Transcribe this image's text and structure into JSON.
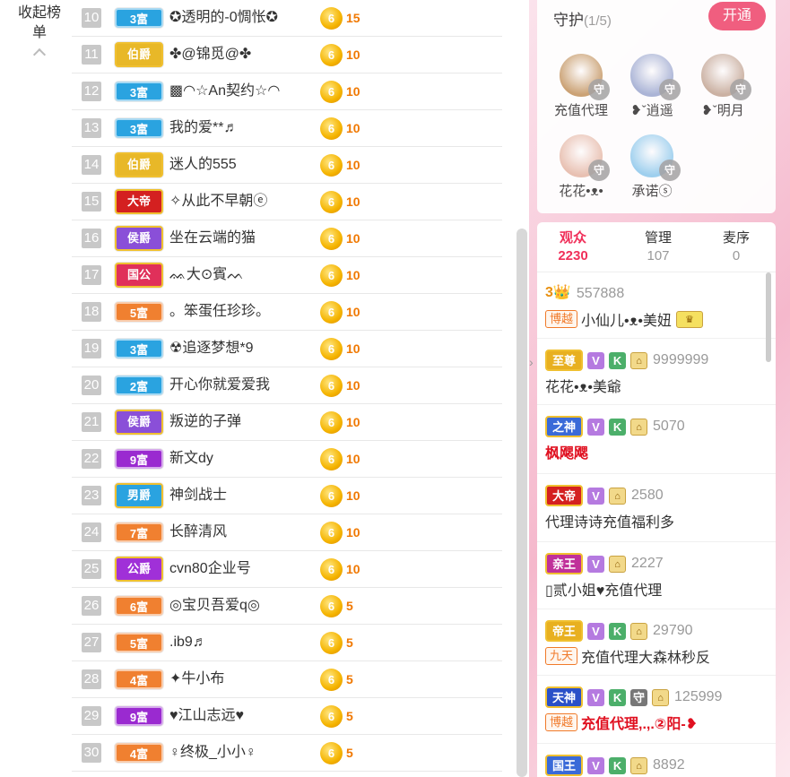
{
  "collapse_label": "收起榜单",
  "ranking": [
    {
      "rank": "10",
      "badge": "3富",
      "badge_color": "#2aa3e0",
      "name": "✪透明的-0惆怅✪",
      "score": "15"
    },
    {
      "rank": "11",
      "badge": "伯爵",
      "badge_color": "#e8b828",
      "name": "✤@锦觅@✤",
      "score": "10"
    },
    {
      "rank": "12",
      "badge": "3富",
      "badge_color": "#2aa3e0",
      "name": "▩◠☆An契约☆◠",
      "score": "10"
    },
    {
      "rank": "13",
      "badge": "3富",
      "badge_color": "#2aa3e0",
      "name": "我的爱**♬",
      "score": "10"
    },
    {
      "rank": "14",
      "badge": "伯爵",
      "badge_color": "#e8b828",
      "name": "迷人的555",
      "score": "10"
    },
    {
      "rank": "15",
      "badge": "大帝",
      "badge_color": "#d42020",
      "name": "✧从此不早朝ⓔ",
      "score": "10"
    },
    {
      "rank": "16",
      "badge": "侯爵",
      "badge_color": "#8a4fd8",
      "name": "坐在云端的猫",
      "score": "10"
    },
    {
      "rank": "17",
      "badge": "国公",
      "badge_color": "#e0305a",
      "name": "ᨐ大⊙賓ᨓ",
      "score": "10"
    },
    {
      "rank": "18",
      "badge": "5富",
      "badge_color": "#f08030",
      "name": "。笨蛋任珍珍。",
      "score": "10"
    },
    {
      "rank": "19",
      "badge": "3富",
      "badge_color": "#2aa3e0",
      "name": "☢追逐梦想*9",
      "score": "10"
    },
    {
      "rank": "20",
      "badge": "2富",
      "badge_color": "#2aa3e0",
      "name": "开心你就爱爱我",
      "score": "10"
    },
    {
      "rank": "21",
      "badge": "侯爵",
      "badge_color": "#8a4fd8",
      "name": "叛逆的子弹",
      "score": "10"
    },
    {
      "rank": "22",
      "badge": "9富",
      "badge_color": "#9a2ad0",
      "name": "新文dy",
      "score": "10"
    },
    {
      "rank": "23",
      "badge": "男爵",
      "badge_color": "#2aa3e0",
      "name": "神剑战士",
      "score": "10"
    },
    {
      "rank": "24",
      "badge": "7富",
      "badge_color": "#f08030",
      "name": "长醉清风",
      "score": "10"
    },
    {
      "rank": "25",
      "badge": "公爵",
      "badge_color": "#a030d8",
      "name": "cvn80企业号",
      "score": "10"
    },
    {
      "rank": "26",
      "badge": "6富",
      "badge_color": "#f08030",
      "name": "◎宝贝吾爱q◎",
      "score": "5"
    },
    {
      "rank": "27",
      "badge": "5富",
      "badge_color": "#f08030",
      "name": ".ib9♬",
      "score": "5"
    },
    {
      "rank": "28",
      "badge": "4富",
      "badge_color": "#f08030",
      "name": "✦牛小布",
      "score": "5"
    },
    {
      "rank": "29",
      "badge": "9富",
      "badge_color": "#9a2ad0",
      "name": "♥江山志远♥",
      "score": "5"
    },
    {
      "rank": "30",
      "badge": "4富",
      "badge_color": "#f08030",
      "name": "♀终极_小小♀",
      "score": "5"
    }
  ],
  "coin_symbol": "6",
  "guard": {
    "title": "守护",
    "count": "(1/5)",
    "open_label": "开通",
    "guard_tag": "守",
    "members": [
      {
        "name": "充值代理",
        "color": "#c9a070"
      },
      {
        "name": "❥ˇ逍遥",
        "color": "#a7b3d6"
      },
      {
        "name": "❥ˇ明月",
        "color": "#c9b0a0"
      },
      {
        "name": "花花•ᴥ•",
        "color": "#e8c0b0"
      },
      {
        "name": "承诺ⓢ",
        "color": "#9ad0f0"
      }
    ]
  },
  "audience": {
    "tabs": [
      {
        "label": "观众",
        "count": "2230"
      },
      {
        "label": "管理",
        "count": "107"
      },
      {
        "label": "麦序",
        "count": "0"
      }
    ],
    "users": [
      {
        "badge": "3👑",
        "badge_color": "#f0a020",
        "icons": [],
        "id": "557888",
        "fan": "博越",
        "name": "小仙儿•ᴥ•美妞"
      },
      {
        "badge": "至尊",
        "badge_color": "#e8b020",
        "icons": [
          "V",
          "K",
          "H"
        ],
        "id": "9999999",
        "fan": "",
        "name": "花花•ᴥ•美爺"
      },
      {
        "badge": "之神",
        "badge_color": "#3a6ad8",
        "icons": [
          "V",
          "K",
          "H"
        ],
        "id": "5070",
        "fan": "",
        "name": "枫飔飔"
      },
      {
        "badge": "大帝",
        "badge_color": "#d42020",
        "icons": [
          "V",
          "H"
        ],
        "id": "2580",
        "fan": "",
        "name": "代理诗诗充值福利多"
      },
      {
        "badge": "亲王",
        "badge_color": "#c0309a",
        "icons": [
          "V",
          "H"
        ],
        "id": "2227",
        "fan": "",
        "name": "▯贰小姐♥充值代理"
      },
      {
        "badge": "帝王",
        "badge_color": "#e8b020",
        "icons": [
          "V",
          "K",
          "H"
        ],
        "id": "29790",
        "fan": "九天",
        "name": "充值代理大森林秒反"
      },
      {
        "badge": "天神",
        "badge_color": "#2a50c8",
        "icons": [
          "V",
          "K",
          "S",
          "H"
        ],
        "id": "125999",
        "fan": "博越",
        "name": "充值代理,.,.②阳-❥"
      },
      {
        "badge": "国王",
        "badge_color": "#3a6ad8",
        "icons": [
          "V",
          "K",
          "H"
        ],
        "id": "8892",
        "fan": "",
        "name": ""
      }
    ]
  }
}
